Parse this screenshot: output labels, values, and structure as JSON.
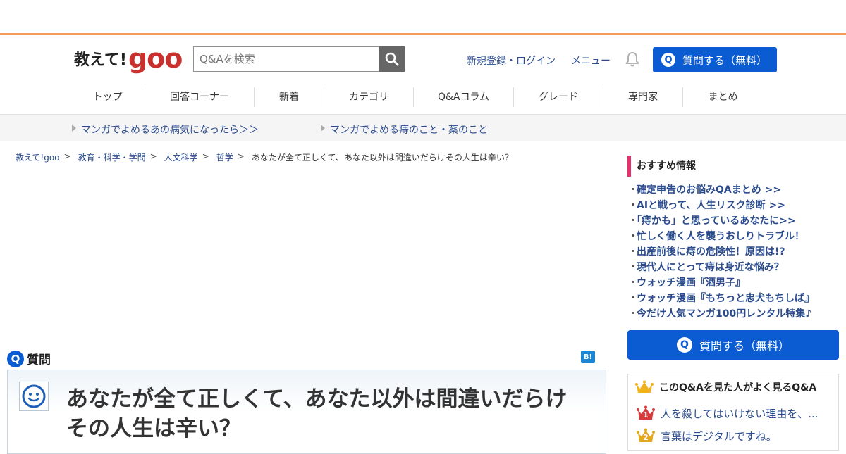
{
  "header": {
    "logo_text": "教えて!",
    "logo_goo": "goo",
    "search_placeholder": "Q&Aを検索",
    "links": [
      "新規登録・ログイン",
      "メニュー"
    ],
    "ask_label": "質問する（無料）",
    "q_letter": "Q"
  },
  "nav": [
    {
      "label": "トップ",
      "w": 106
    },
    {
      "label": "回答コーナー",
      "w": 155
    },
    {
      "label": "新着",
      "w": 99
    },
    {
      "label": "カテゴリ",
      "w": 127
    },
    {
      "label": "Q&Aコラム",
      "w": 142
    },
    {
      "label": "グレード",
      "w": 127
    },
    {
      "label": "専門家",
      "w": 113
    },
    {
      "label": "まとめ",
      "w": 113
    }
  ],
  "sub_links": [
    "マンガでよめるあの病気になったら＞＞",
    "マンガでよめる痔のこと・薬のこと"
  ],
  "breadcrumb": {
    "items": [
      "教えて!goo",
      "教育・科学・学問",
      "人文科学",
      "哲学"
    ],
    "sep": ">",
    "current": "あなたが全て正しくて、あなた以外は間違いだらけその人生は辛い？"
  },
  "question": {
    "badge": "Q",
    "label": "質問",
    "hatena": "B!",
    "title": "あなたが全て正しくて、あなた以外は間違いだらけその人生は辛い？"
  },
  "sidebar": {
    "heading": "おすすめ情報",
    "items": [
      "確定申告のお悩みQAまとめ >>",
      "AIと戦って、人生リスク診断 >>",
      "「痔かも」と思っているあなたに>>",
      "忙しく働く人を襲うおしりトラブル！",
      "出産前後に痔の危険性！原因は!?",
      "現代人にとって痔は身近な悩み？",
      "ウォッチ漫画『酒男子』",
      "ウォッチ漫画『もちっと忠犬もちしば』",
      "今だけ人気マンガ100円レンタル特集♪"
    ],
    "ask_label": "質問する（無料）",
    "related_heading": "このQ&Aを見た人がよく見るQ&A",
    "related": [
      {
        "rank": "1",
        "title": "人を殺してはいけない理由を、..."
      },
      {
        "rank": "2",
        "title": "言葉はデジタルですね。"
      }
    ]
  },
  "colors": {
    "accent_blue": "#0b5bd3",
    "link_blue": "#2a4b8d",
    "orange_rule": "#f39a5c",
    "pink_bar": "#e2326b",
    "goo_red": "#c8312e"
  }
}
